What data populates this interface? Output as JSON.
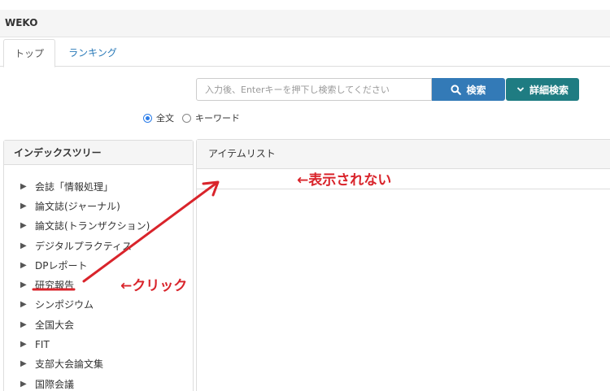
{
  "app": {
    "brand": "WEKO"
  },
  "tabs": [
    {
      "label": "トップ"
    },
    {
      "label": "ランキング"
    }
  ],
  "search": {
    "placeholder": "入力後、Enterキーを押下し検索してください",
    "value": "",
    "search_button": "検索",
    "detail_button": "詳細検索"
  },
  "search_mode": {
    "options": [
      "全文",
      "キーワード"
    ],
    "selected": "全文"
  },
  "index_tree": {
    "title": "インデックスツリー",
    "items": [
      "会誌「情報処理」",
      "論文誌(ジャーナル)",
      "論文誌(トランザクション)",
      "デジタルプラクティス",
      "DPレポート",
      "研究報告",
      "シンポジウム",
      "全国大会",
      "FIT",
      "支部大会論文集",
      "国際会議"
    ]
  },
  "item_list": {
    "title": "アイテムリスト"
  },
  "annotations": {
    "not_shown": "←表示されない",
    "click": "←クリック",
    "color": "#d9242b"
  },
  "colors": {
    "search_button": "#337ab7",
    "detail_button": "#1f7c82",
    "link": "#2a7ab8"
  },
  "icons": {
    "search": "search-icon",
    "detail": "chevron-down-icon",
    "tree": "triangle-right-icon"
  }
}
